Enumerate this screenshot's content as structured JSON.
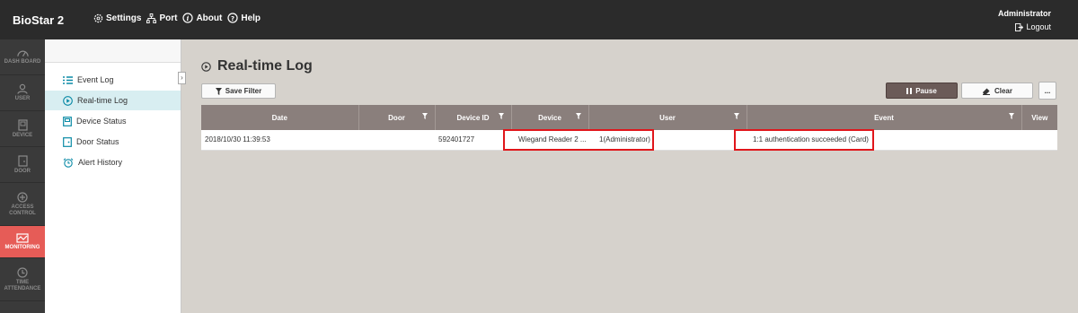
{
  "header": {
    "brand": "BioStar 2",
    "menu": [
      {
        "label": "Settings",
        "icon": "gear-icon"
      },
      {
        "label": "Port",
        "icon": "network-icon"
      },
      {
        "label": "About",
        "icon": "info-icon"
      },
      {
        "label": "Help",
        "icon": "help-icon"
      }
    ],
    "user": "Administrator",
    "logout": "Logout"
  },
  "nav": [
    {
      "label": "DASH BOARD",
      "icon": "dashboard-icon"
    },
    {
      "label": "USER",
      "icon": "user-icon"
    },
    {
      "label": "DEVICE",
      "icon": "device-icon"
    },
    {
      "label": "DOOR",
      "icon": "door-icon"
    },
    {
      "label": "ACCESS CONTROL",
      "icon": "access-control-icon"
    },
    {
      "label": "MONITORING",
      "icon": "monitoring-icon",
      "active": true
    },
    {
      "label": "TIME ATTENDANCE",
      "icon": "clock-icon"
    }
  ],
  "submenu": [
    {
      "label": "Event Log",
      "icon": "list-icon"
    },
    {
      "label": "Real-time Log",
      "icon": "play-icon",
      "active": true
    },
    {
      "label": "Device Status",
      "icon": "device-status-icon"
    },
    {
      "label": "Door Status",
      "icon": "door-status-icon"
    },
    {
      "label": "Alert History",
      "icon": "alarm-icon"
    }
  ],
  "page": {
    "title": "Real-time Log",
    "save_filter": "Save Filter",
    "pause": "Pause",
    "clear": "Clear",
    "more": "..."
  },
  "table": {
    "columns": [
      "Date",
      "Door",
      "Device ID",
      "Device",
      "User",
      "Event",
      "View"
    ],
    "rows": [
      {
        "date": "2018/10/30 11:39:53",
        "door": "",
        "device_id": "592401727",
        "device": "Wiegand Reader 2 ...",
        "user": "1(Administrator)",
        "event": "1:1 authentication succeeded (Card)",
        "view": ""
      }
    ]
  },
  "colors": {
    "accent": "#e65c57",
    "topbar": "#2b2b2b",
    "header": "#8a7f7c",
    "highlight": "#e0161b"
  }
}
